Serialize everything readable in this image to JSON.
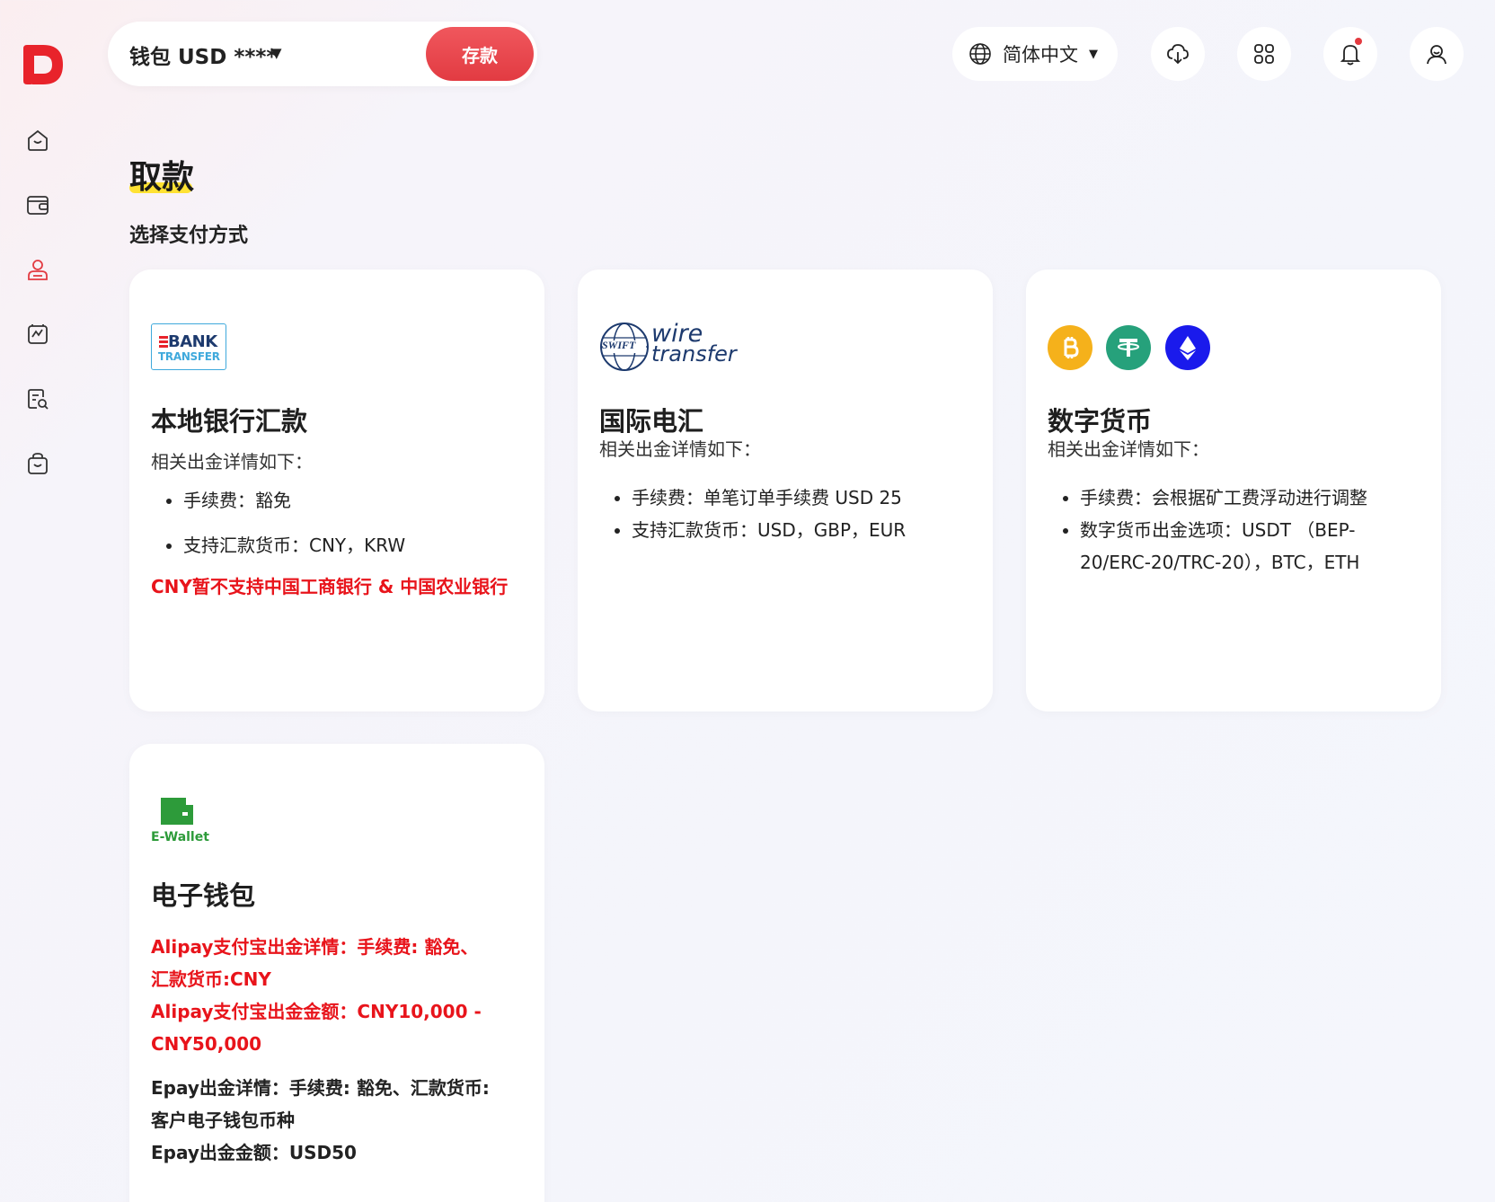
{
  "header": {
    "wallet_label": "钱包 USD ****",
    "wallet_caret": "▼",
    "deposit_label": "存款",
    "language": "简体中文",
    "language_caret": "▼"
  },
  "page": {
    "title": "取款",
    "section_label": "选择支付方式"
  },
  "cards": {
    "bank": {
      "logo_line1": "BANK",
      "logo_line2": "TRANSFER",
      "title": "本地银行汇款",
      "subtitle": "相关出金详情如下：",
      "items": [
        "手续费：豁免",
        "支持汇款货币：CNY，KRW"
      ],
      "note": "CNY暂不支持中国工商银行 & 中国农业银行"
    },
    "wire": {
      "logo_swift": "SWIFT",
      "logo_wire": "wire",
      "logo_transfer": "transfer",
      "title": "国际电汇",
      "subtitle": "相关出金详情如下：",
      "items": [
        "手续费：单笔订单手续费 USD 25",
        "支持汇款货币：USD，GBP，EUR"
      ]
    },
    "crypto": {
      "title": "数字货币",
      "subtitle": "相关出金详情如下：",
      "items": [
        "手续费：会根据矿工费浮动进行调整",
        "数字货币出金选项：USDT （BEP-20/ERC-20/TRC-20），BTC，ETH"
      ]
    },
    "ewallet": {
      "logo_text": "E-Wallet",
      "title": "电子钱包",
      "alipay_detail": "Alipay支付宝出金详情：手续费: 豁免、汇款货币:CNY",
      "alipay_amount": "Alipay支付宝出金金额：CNY10,000 - CNY50,000",
      "epay_detail": "Epay出金详情：手续费: 豁免、汇款货币:客户电子钱包币种",
      "epay_amount": "Epay出金金额：USD50"
    }
  },
  "colors": {
    "brand_red": "#e23b42",
    "warning_red": "#e8141b",
    "highlight_yellow": "#ffe233"
  },
  "icons": {
    "sidebar": [
      "home-icon",
      "wallet-icon",
      "user-icon",
      "chart-icon",
      "document-search-icon",
      "shopping-bag-icon"
    ],
    "header": [
      "globe-icon",
      "cloud-download-icon",
      "apps-icon",
      "bell-icon",
      "profile-icon"
    ]
  }
}
